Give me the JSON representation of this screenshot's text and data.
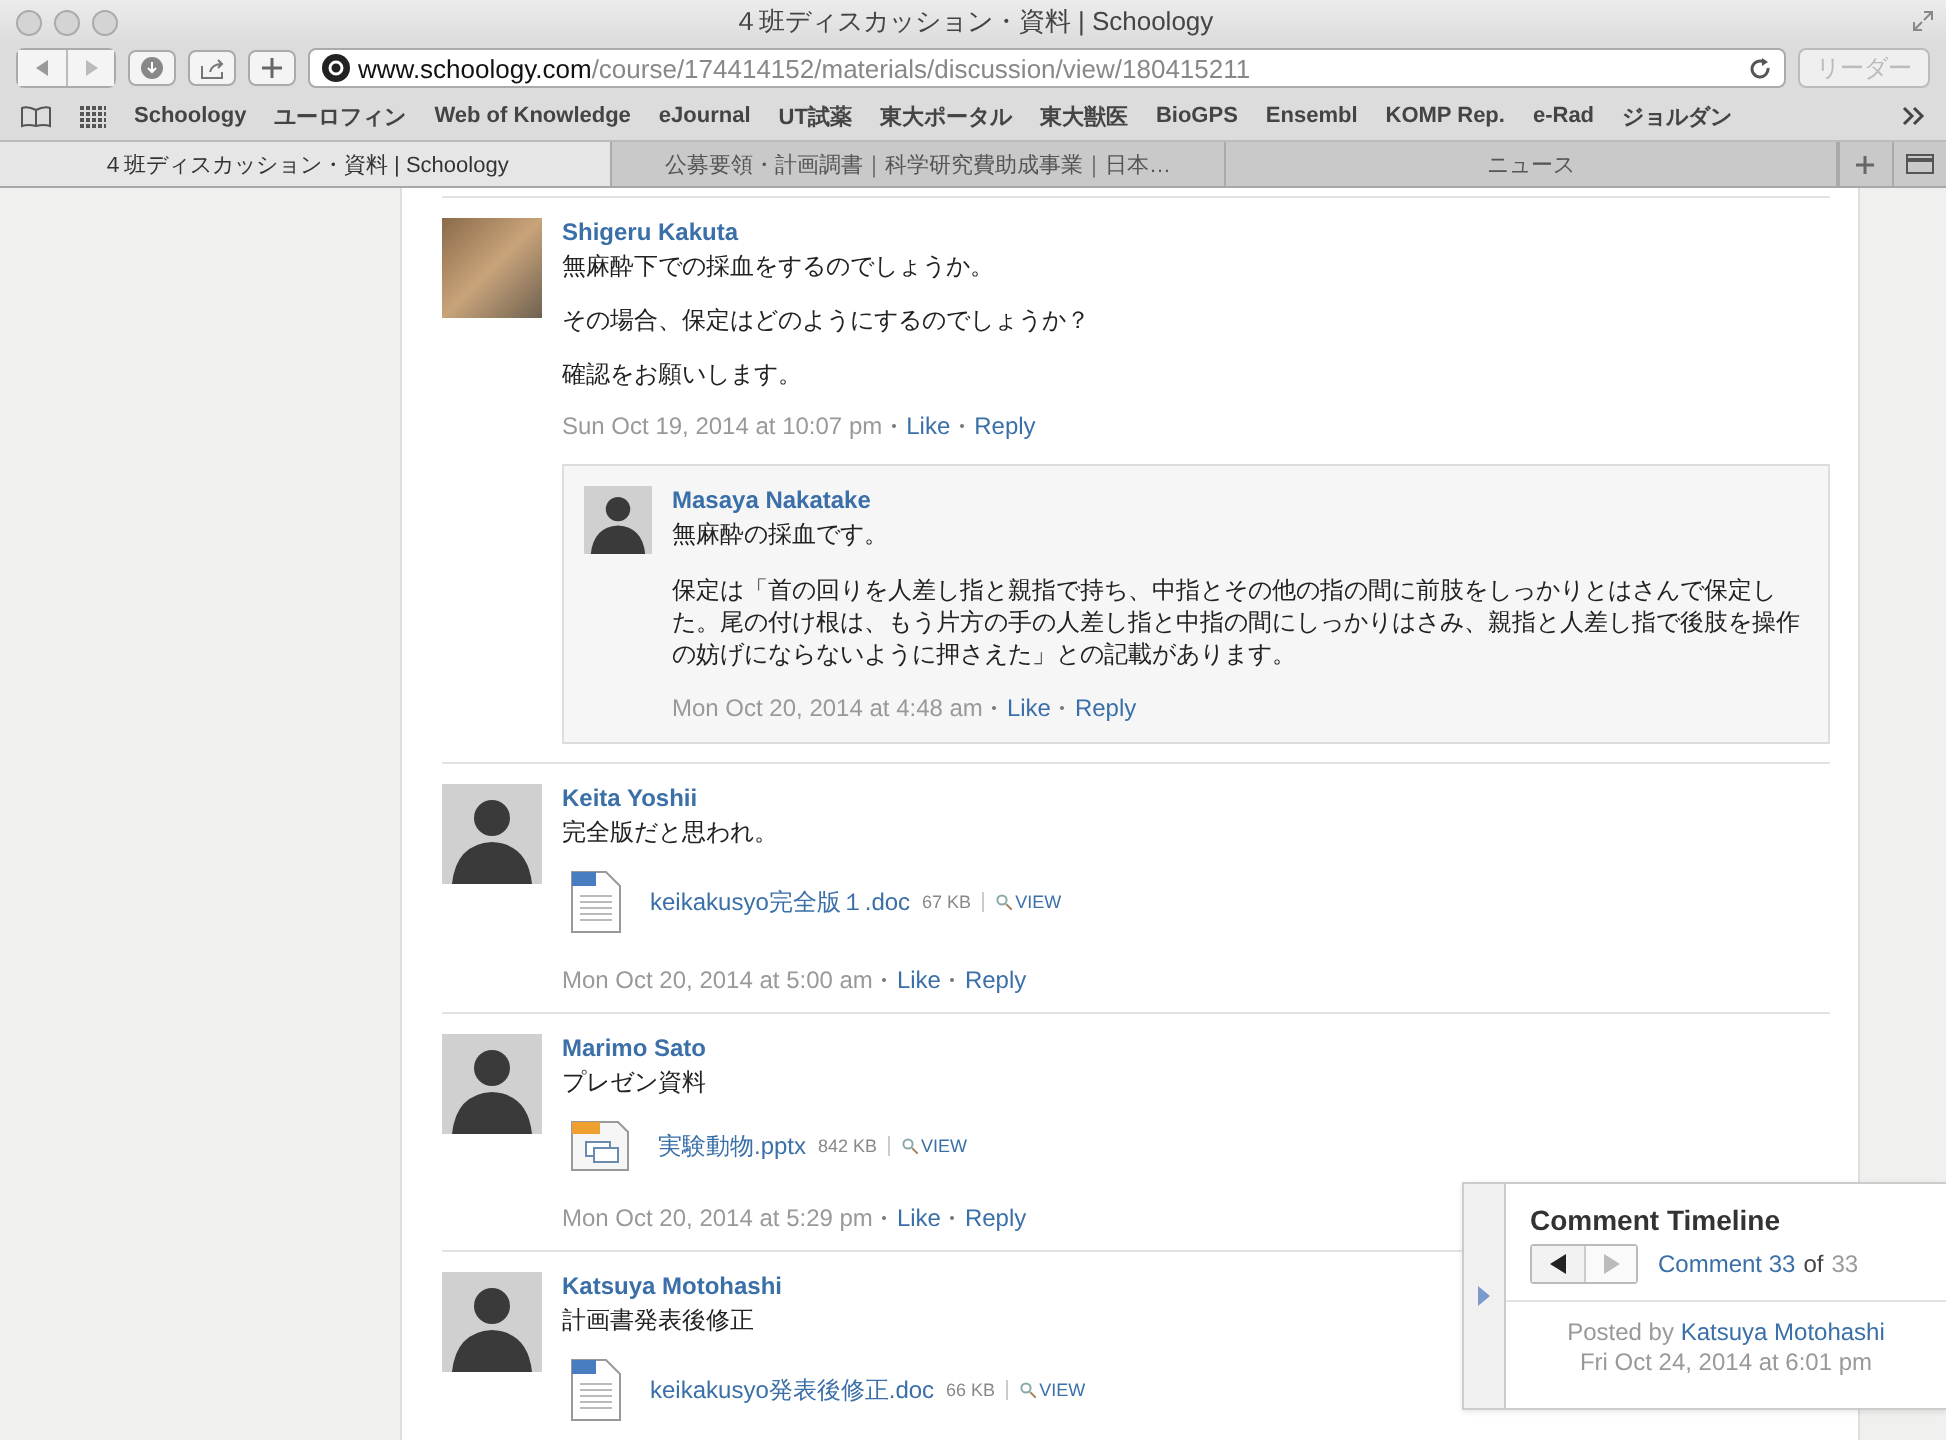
{
  "window": {
    "title": "４班ディスカッション・資料 | Schoology"
  },
  "toolbar": {
    "url_domain": "www.schoology.com",
    "url_path": "/course/174414152/materials/discussion/view/180415211",
    "reader": "リーダー"
  },
  "bookmarks": [
    "Schoology",
    "ユーロフィン",
    "Web of Knowledge",
    "eJournal",
    "UT試薬",
    "東大ポータル",
    "東大獣医",
    "BioGPS",
    "Ensembl",
    "KOMP Rep.",
    "e-Rad",
    "ジョルダン"
  ],
  "tabs": [
    {
      "label": "４班ディスカッション・資料 | Schoology",
      "selected": true
    },
    {
      "label": "公募要領・計画調書｜科学研究費助成事業｜日本…",
      "selected": false
    },
    {
      "label": "ニュース",
      "selected": false
    }
  ],
  "comments": [
    {
      "author": "Shigeru Kakuta",
      "kind": "photo",
      "paragraphs": [
        "無麻酔下での採血をするのでしょうか。",
        "その場合、保定はどのようにするのでしょうか？",
        "確認をお願いします。"
      ],
      "time": "Sun Oct 19, 2014 at 10:07 pm",
      "actions": [
        "Like",
        "Reply"
      ],
      "replies": [
        {
          "author": "Masaya Nakatake",
          "kind": "silhouette",
          "paragraphs": [
            "無麻酔の採血です。",
            "保定は「首の回りを人差し指と親指で持ち、中指とその他の指の間に前肢をしっかりとはさんで保定した。尾の付け根は、もう片方の手の人差し指と中指の間にしっかりはさみ、親指と人差し指で後肢を操作の妨げにならないように押さえた」との記載があります。"
          ],
          "time": "Mon Oct 20, 2014 at 4:48 am",
          "actions": [
            "Like",
            "Reply"
          ]
        }
      ]
    },
    {
      "author": "Keita Yoshii",
      "kind": "silhouette",
      "paragraphs": [
        "完全版だと思われ。"
      ],
      "attachments": [
        {
          "kind": "doc",
          "name": "keikakusyo完全版１.doc",
          "size": "67 KB",
          "view": "VIEW"
        }
      ],
      "time": "Mon Oct 20, 2014 at 5:00 am",
      "actions": [
        "Like",
        "Reply"
      ]
    },
    {
      "author": "Marimo Sato",
      "kind": "silhouette",
      "paragraphs": [
        "プレゼン資料"
      ],
      "attachments": [
        {
          "kind": "pptx",
          "name": "実験動物.pptx",
          "size": "842 KB",
          "view": "VIEW"
        }
      ],
      "time": "Mon Oct 20, 2014 at 5:29 pm",
      "actions": [
        "Like",
        "Reply"
      ]
    },
    {
      "author": "Katsuya Motohashi",
      "kind": "silhouette",
      "paragraphs": [
        "計画書発表後修正"
      ],
      "attachments": [
        {
          "kind": "doc",
          "name": "keikakusyo発表後修正.doc",
          "size": "66 KB",
          "view": "VIEW"
        }
      ]
    }
  ],
  "timeline": {
    "title": "Comment Timeline",
    "current": "Comment 33",
    "of": "of",
    "total": "33",
    "posted_by": "Posted by",
    "author": "Katsuya Motohashi",
    "date": "Fri Oct 24, 2014 at 6:01 pm"
  }
}
